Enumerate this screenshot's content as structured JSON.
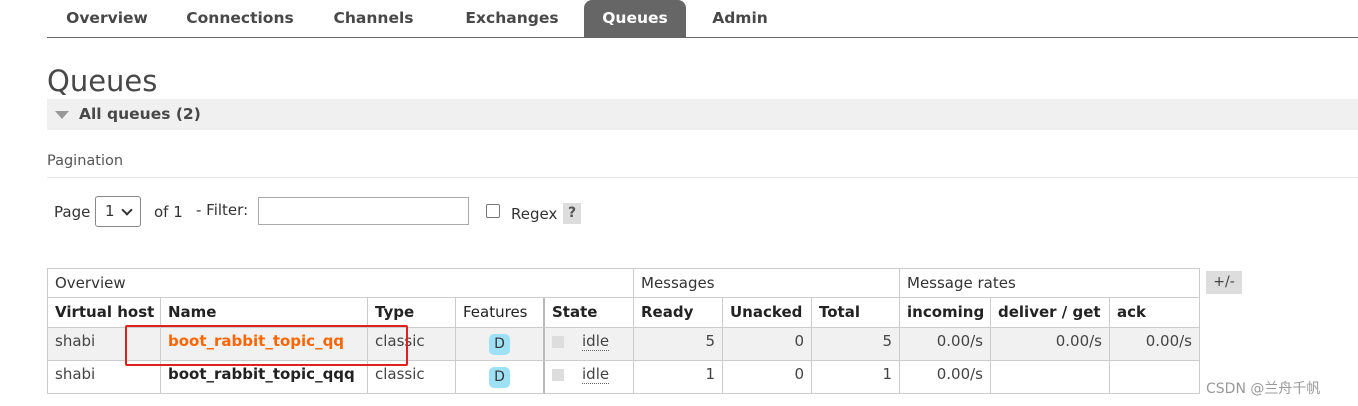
{
  "nav": {
    "tabs": [
      {
        "label": "Overview"
      },
      {
        "label": "Connections"
      },
      {
        "label": "Channels"
      },
      {
        "label": "Exchanges"
      },
      {
        "label": "Queues"
      },
      {
        "label": "Admin"
      }
    ],
    "active": "Queues"
  },
  "page_title": "Queues",
  "section_title": "All queues (2)",
  "pagination": {
    "label": "Pagination",
    "page_label": "Page",
    "page_value": "1",
    "of_label": "of 1",
    "filter_label": "- Filter:",
    "filter_value": "",
    "regex_label": "Regex",
    "help": "?"
  },
  "table": {
    "groups": {
      "overview": "Overview",
      "messages": "Messages",
      "rates": "Message rates"
    },
    "toggle": "+/-",
    "headers": {
      "vhost": "Virtual host",
      "name": "Name",
      "type": "Type",
      "features": "Features",
      "state": "State",
      "ready": "Ready",
      "unacked": "Unacked",
      "total": "Total",
      "incoming": "incoming",
      "deliver": "deliver / get",
      "ack": "ack"
    },
    "rows": [
      {
        "vhost": "shabi",
        "name": "boot_rabbit_topic_qq",
        "type": "classic",
        "feature": "D",
        "state": "idle",
        "ready": "5",
        "unacked": "0",
        "total": "5",
        "incoming": "0.00/s",
        "deliver": "0.00/s",
        "ack": "0.00/s"
      },
      {
        "vhost": "shabi",
        "name": "boot_rabbit_topic_qqq",
        "type": "classic",
        "feature": "D",
        "state": "idle",
        "ready": "1",
        "unacked": "0",
        "total": "1",
        "incoming": "0.00/s",
        "deliver": "",
        "ack": ""
      }
    ]
  },
  "watermark": "CSDN @兰舟千帆",
  "colors": {
    "nav_active": "#666666",
    "queue_link": "#ff6600",
    "feature_badge": "#9ee1f5",
    "highlight": "#e0201f"
  }
}
